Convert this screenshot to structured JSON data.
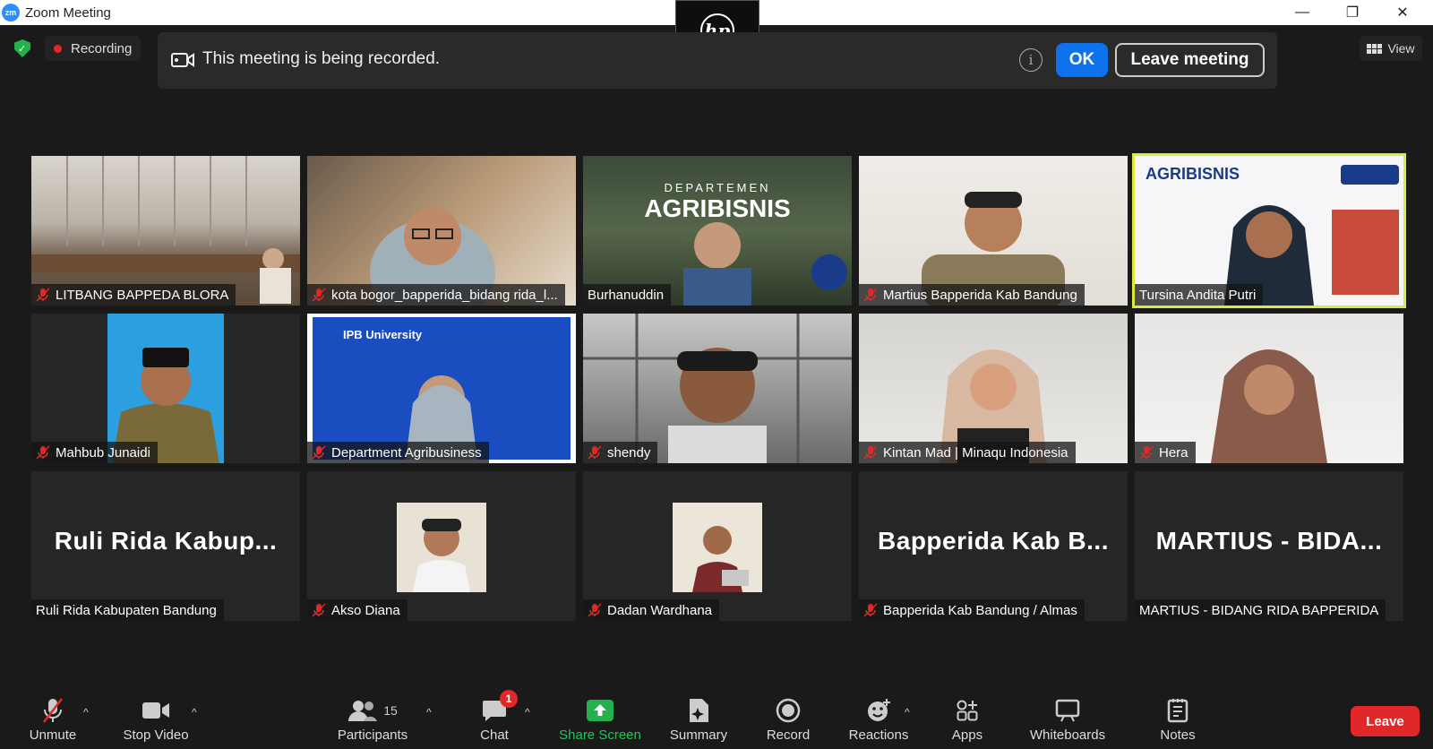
{
  "window": {
    "title": "Zoom Meeting",
    "app_logo": "zm"
  },
  "topbar": {
    "recording_label": "Recording",
    "view_label": "View"
  },
  "banner": {
    "message": "This meeting is being recorded.",
    "ok_label": "OK",
    "leave_meeting_label": "Leave meeting"
  },
  "participants": [
    {
      "name": "LITBANG BAPPEDA BLORA",
      "muted": true,
      "video": "classroom"
    },
    {
      "name": "kota bogor_bapperida_bidang rida_l...",
      "muted": true,
      "video": "woman-hijab-glasses"
    },
    {
      "name": "Burhanuddin",
      "muted": false,
      "video": "agribisnis-background"
    },
    {
      "name": "Martius Bapperida Kab Bandung",
      "muted": true,
      "video": "man-office"
    },
    {
      "name": "Tursina Andita Putri",
      "muted": false,
      "video": "agribisnis-ipb",
      "active_speaker": true
    },
    {
      "name": "Mahbub Junaidi",
      "muted": true,
      "video": "man-uniform"
    },
    {
      "name": "Department Agribusiness",
      "muted": true,
      "video": "ipb-university"
    },
    {
      "name": "shendy",
      "muted": true,
      "video": "man-window"
    },
    {
      "name": "Kintan Mad | Minaqu Indonesia",
      "muted": true,
      "video": "woman-hijab-beige"
    },
    {
      "name": "Hera",
      "muted": true,
      "video": "woman-hijab-brown"
    },
    {
      "name": "Ruli Rida Kabupaten Bandung",
      "muted": false,
      "big_text": "Ruli Rida Kabup..."
    },
    {
      "name": "Akso Diana",
      "muted": true,
      "video": "avatar-man"
    },
    {
      "name": "Dadan Wardhana",
      "muted": true,
      "video": "avatar-man-laptop"
    },
    {
      "name": "Bapperida Kab Bandung / Almas",
      "muted": true,
      "big_text": "Bapperida Kab B..."
    },
    {
      "name": "MARTIUS - BIDANG RIDA BAPPERIDA",
      "muted": false,
      "big_text": "MARTIUS - BIDA..."
    }
  ],
  "toolbar": {
    "unmute": "Unmute",
    "stop_video": "Stop Video",
    "participants": "Participants",
    "participants_count": "15",
    "chat": "Chat",
    "chat_badge": "1",
    "share_screen": "Share Screen",
    "summary": "Summary",
    "record": "Record",
    "reactions": "Reactions",
    "apps": "Apps",
    "whiteboards": "Whiteboards",
    "notes": "Notes",
    "leave": "Leave"
  },
  "colors": {
    "share_green": "#22b14c",
    "leave_red": "#e02828",
    "ok_blue": "#0e72ed",
    "active_speaker": "#d9ec3a"
  }
}
